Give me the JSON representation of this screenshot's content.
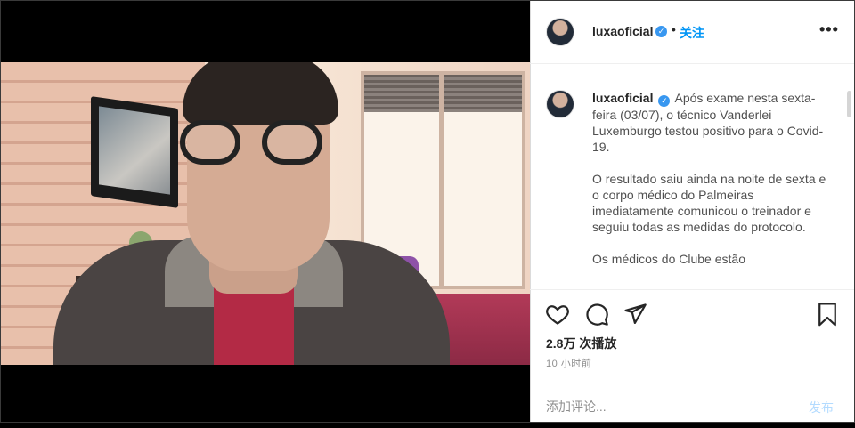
{
  "header": {
    "username": "luxaoficial",
    "verified_mark": "✓",
    "separator": "•",
    "follow_label": "关注",
    "more_label": "•••"
  },
  "caption": {
    "username": "luxaoficial",
    "paragraphs": [
      "Após exame nesta sexta-feira (03/07), o técnico Vanderlei Luxemburgo testou positivo para o Covid-19.",
      "O resultado saiu ainda na noite de sexta e o corpo médico do Palmeiras imediatamente comunicou o treinador e seguiu todas as medidas do protocolo.",
      "Os médicos do Clube estão"
    ]
  },
  "actions": {
    "icons": [
      "heart-icon",
      "comment-icon",
      "share-icon",
      "bookmark-icon"
    ],
    "views": "2.8万 次播放",
    "time_ago": "10 小时前"
  },
  "comment": {
    "placeholder": "添加评论...",
    "post_label": "发布"
  },
  "colors": {
    "accent": "#0095f6",
    "verified": "#3897f0",
    "post_disabled": "#b3dbff",
    "text": "#262626",
    "muted": "#8e8e8e"
  }
}
